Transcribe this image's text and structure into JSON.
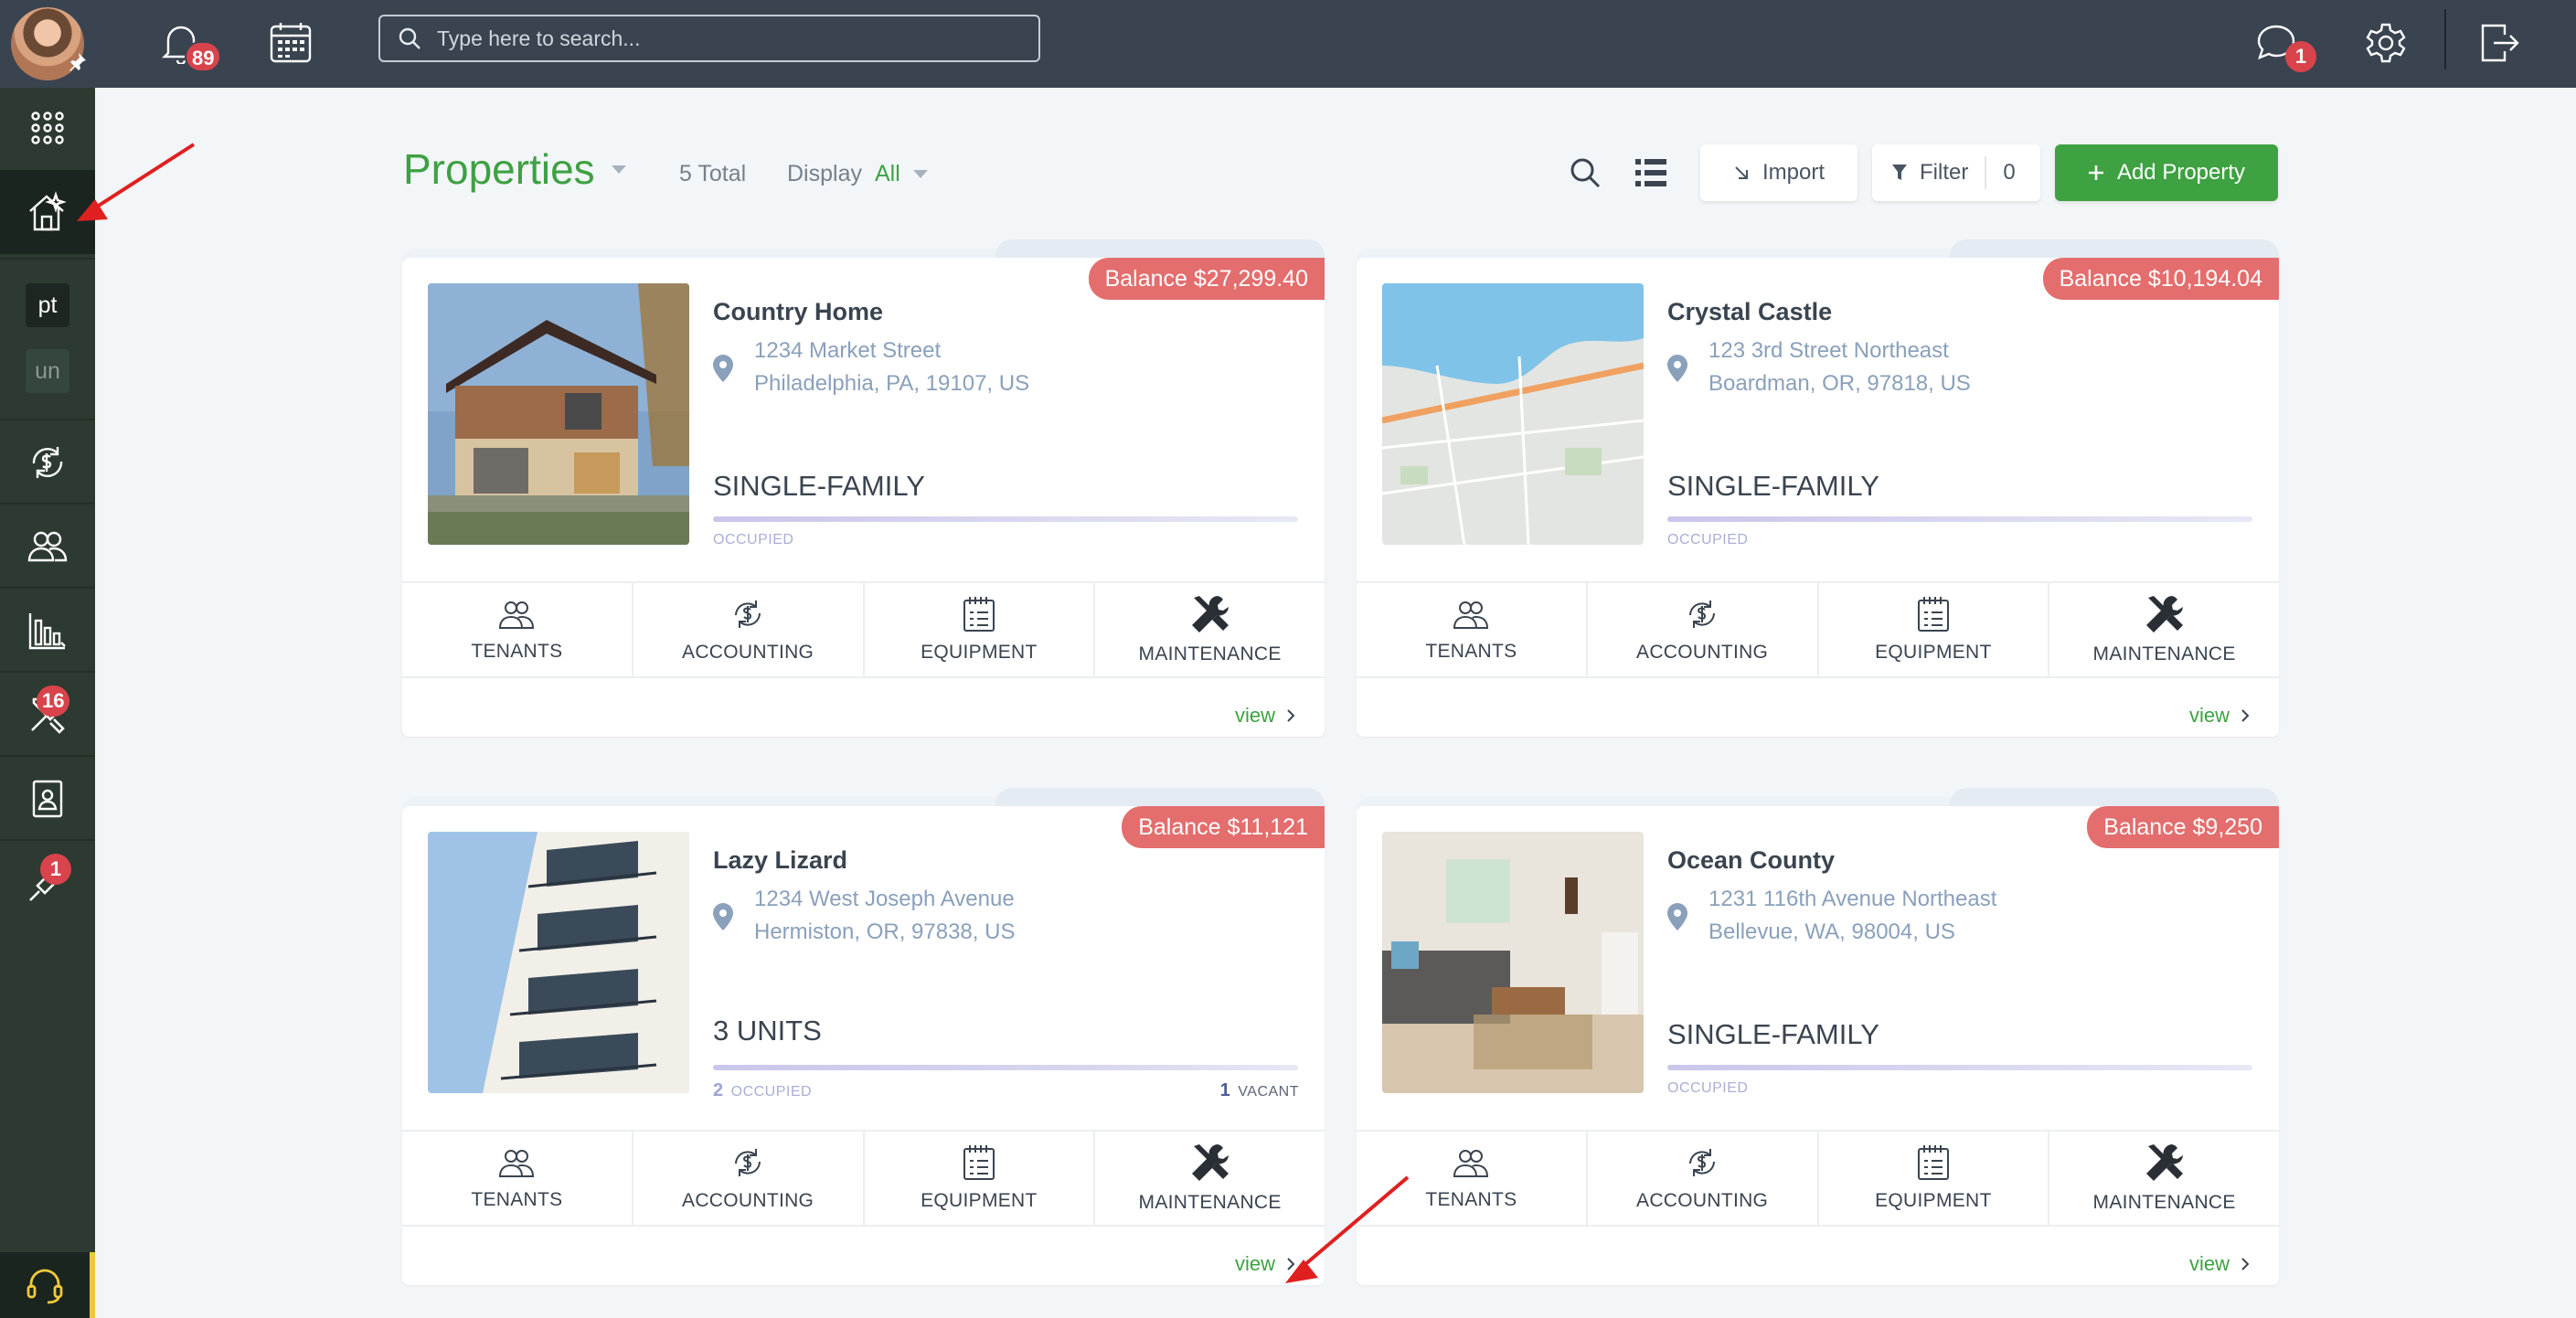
{
  "topbar": {
    "notifications_count": "89",
    "search_placeholder": "Type here to search...",
    "messages_count": "1"
  },
  "sidebar": {
    "item_pt": "pt",
    "item_un": "un",
    "maintenance_badge": "16",
    "tools_badge": "1"
  },
  "header": {
    "title": "Properties",
    "total": "5 Total",
    "display_label": "Display",
    "display_value": "All",
    "import_label": "Import",
    "filter_label": "Filter",
    "filter_count": "0",
    "add_label": "Add Property"
  },
  "action_labels": {
    "tenants": "TENANTS",
    "accounting": "ACCOUNTING",
    "equipment": "EQUIPMENT",
    "maintenance": "MAINTENANCE",
    "view": "view"
  },
  "properties": [
    {
      "balance": "Balance $27,299.40",
      "name": "Country Home",
      "street": "1234 Market Street",
      "city": "Philadelphia, PA, 19107, US",
      "type": "SINGLE-FAMILY",
      "occupied_label": "OCCUPIED"
    },
    {
      "balance": "Balance $10,194.04",
      "name": "Crystal Castle",
      "street": "123 3rd Street Northeast",
      "city": "Boardman, OR, 97818, US",
      "type": "SINGLE-FAMILY",
      "occupied_label": "OCCUPIED"
    },
    {
      "balance": "Balance $11,121",
      "name": "Lazy Lizard",
      "street": "1234 West Joseph Avenue",
      "city": "Hermiston, OR, 97838, US",
      "type": "3 UNITS",
      "occupied_count": "2",
      "occupied_label": "OCCUPIED",
      "vacant_count": "1",
      "vacant_label": "VACANT"
    },
    {
      "balance": "Balance $9,250",
      "name": "Ocean County",
      "street": "1231 116th Avenue Northeast",
      "city": "Bellevue, WA, 98004, US",
      "type": "SINGLE-FAMILY",
      "occupied_label": "OCCUPIED"
    }
  ],
  "colors": {
    "brand_green": "#3ea142",
    "balance_red": "#e46d6d",
    "topbar": "#3a4450",
    "sidebar": "#2c3a31",
    "annotation_arrow": "#e02020"
  }
}
